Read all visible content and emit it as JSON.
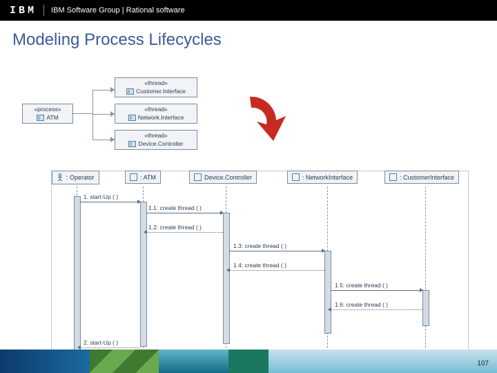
{
  "header": {
    "logo": "IBM",
    "group": "IBM Software Group | Rational software"
  },
  "title": "Modeling Process Lifecycles",
  "pagenum": "107",
  "class_diagram": {
    "process": {
      "stereotype": "«process»",
      "name": "ATM"
    },
    "threads": [
      {
        "stereotype": "«thread»",
        "name": "Customer.Interface"
      },
      {
        "stereotype": "«thread»",
        "name": "Network.Interface"
      },
      {
        "stereotype": "«thread»",
        "name": "Device.Controller"
      }
    ]
  },
  "sequence": {
    "lifelines": [
      {
        "label": ": Operator"
      },
      {
        "label": ": ATM"
      },
      {
        "label": "Device.Controller"
      },
      {
        "label": ": NetworkInterface"
      },
      {
        "label": ": CustomerInterface"
      }
    ],
    "messages": [
      {
        "label": "1. start-Up ( )"
      },
      {
        "label": "1.1: create thread ( )"
      },
      {
        "label": "1.2: create thread ( )"
      },
      {
        "label": "1.3: create thread ( )"
      },
      {
        "label": "1.4: create thread ( )"
      },
      {
        "label": "1.5: create thread ( )"
      },
      {
        "label": "1.6: create thread ( )"
      },
      {
        "label": "2. start-Up ( )"
      }
    ]
  }
}
